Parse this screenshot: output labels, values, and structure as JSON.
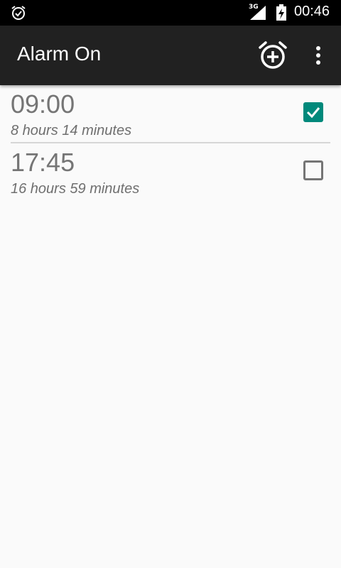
{
  "status_bar": {
    "network": "3G",
    "time": "00:46"
  },
  "app_bar": {
    "title": "Alarm On",
    "add_alarm_icon": "alarm-add-icon",
    "overflow_icon": "more-vert-icon"
  },
  "alarms": [
    {
      "time": "09:00",
      "until": "8 hours 14 minutes",
      "enabled": true
    },
    {
      "time": "17:45",
      "until": "16 hours 59 minutes",
      "enabled": false
    }
  ],
  "colors": {
    "app_bar": "#212121",
    "accent": "#00897b",
    "background": "#fafafa"
  }
}
